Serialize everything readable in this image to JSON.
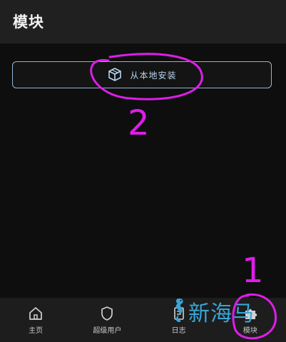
{
  "header": {
    "title": "模块"
  },
  "main": {
    "install_button": {
      "label": "从本地安装",
      "icon": "package-icon"
    }
  },
  "annotations": {
    "step_one": "1",
    "step_two": "2",
    "color": "#dd1ee8"
  },
  "bottom_nav": {
    "items": [
      {
        "label": "主页",
        "icon": "home-icon"
      },
      {
        "label": "超级用户",
        "icon": "shield-icon"
      },
      {
        "label": "日志",
        "icon": "log-icon"
      },
      {
        "label": "模块",
        "icon": "puzzle-icon"
      }
    ]
  },
  "watermark": {
    "text": "新海马"
  },
  "colors": {
    "background": "#0e0e0e",
    "header": "#202020",
    "accent": "#8fb6d8",
    "nav": "#1d1d1d"
  }
}
